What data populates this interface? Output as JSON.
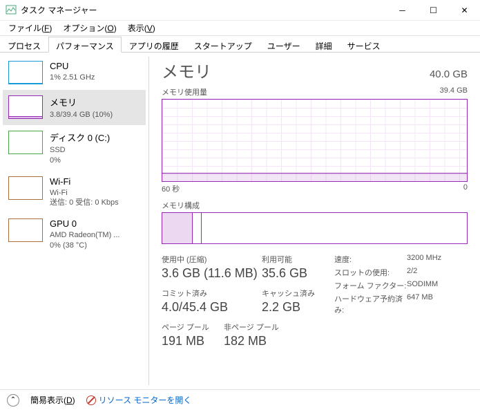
{
  "window": {
    "title": "タスク マネージャー"
  },
  "menu": {
    "file": "ファイル(",
    "file_u": "F",
    "options": "オプション(",
    "options_u": "O",
    "view": "表示(",
    "view_u": "V",
    "close": ")"
  },
  "tabs": {
    "processes": "プロセス",
    "performance": "パフォーマンス",
    "apphistory": "アプリの履歴",
    "startup": "スタートアップ",
    "users": "ユーザー",
    "details": "詳細",
    "services": "サービス"
  },
  "sidebar": {
    "cpu": {
      "title": "CPU",
      "sub": "1%  2.51 GHz"
    },
    "mem": {
      "title": "メモリ",
      "sub": "3.8/39.4 GB (10%)"
    },
    "disk": {
      "title": "ディスク 0 (C:)",
      "sub1": "SSD",
      "sub2": "0%"
    },
    "wifi": {
      "title": "Wi-Fi",
      "sub1": "Wi-Fi",
      "sub2": "送信: 0 受信: 0 Kbps"
    },
    "gpu": {
      "title": "GPU 0",
      "sub1": "AMD Radeon(TM) ...",
      "sub2": "0%  (38 °C)"
    }
  },
  "main": {
    "title": "メモリ",
    "capacity": "40.0 GB",
    "usage_label": "メモリ使用量",
    "usage_max": "39.4 GB",
    "axis_left": "60 秒",
    "axis_right": "0",
    "comp_label": "メモリ構成",
    "stats": {
      "inuse_lbl": "使用中 (圧縮)",
      "inuse_val": "3.6 GB (11.6 MB)",
      "avail_lbl": "利用可能",
      "avail_val": "35.6 GB",
      "commit_lbl": "コミット済み",
      "commit_val": "4.0/45.4 GB",
      "cache_lbl": "キャッシュ済み",
      "cache_val": "2.2 GB",
      "paged_lbl": "ページ プール",
      "paged_val": "191 MB",
      "nonpaged_lbl": "非ページ プール",
      "nonpaged_val": "182 MB"
    },
    "right": {
      "speed_k": "速度:",
      "speed_v": "3200 MHz",
      "slots_k": "スロットの使用:",
      "slots_v": "2/2",
      "form_k": "フォーム ファクター:",
      "form_v": "SODIMM",
      "hw_k": "ハードウェア予約済み:",
      "hw_v": "647 MB"
    }
  },
  "footer": {
    "fewer": "簡易表示(",
    "fewer_u": "D",
    "close": ")",
    "resmon": "リソース モニターを開く"
  }
}
